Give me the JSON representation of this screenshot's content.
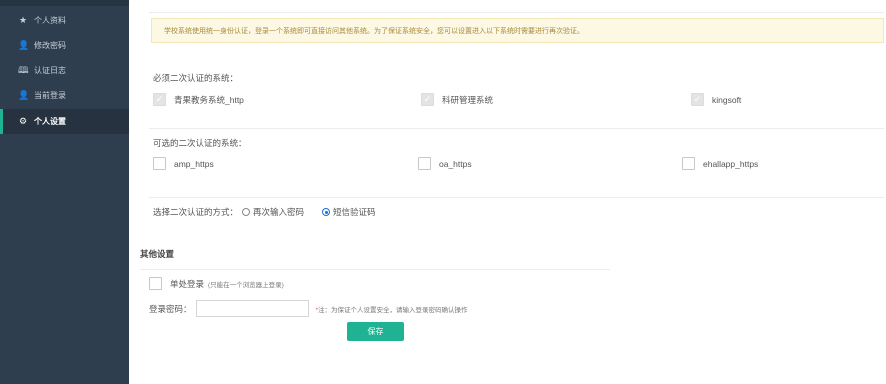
{
  "sidebar": {
    "items": [
      {
        "label": "个人资料",
        "icon": "star-icon",
        "glyph": "★"
      },
      {
        "label": "修改密码",
        "icon": "user-icon",
        "glyph": "👤"
      },
      {
        "label": "认证日志",
        "icon": "book-icon",
        "glyph": "🕮"
      },
      {
        "label": "当前登录",
        "icon": "user-lock-icon",
        "glyph": "👤"
      },
      {
        "label": "个人设置",
        "icon": "gear-icon",
        "glyph": "⚙"
      }
    ],
    "active_index": 4
  },
  "notice": "学校系统使用统一身份认证，登录一个系统即可直接访问其他系统。为了保证系统安全，您可以设置进入以下系统时需要进行再次验证。",
  "required": {
    "title": "必须二次认证的系统：",
    "systems": [
      "青果教务系统_http",
      "科研管理系统",
      "kingsoft"
    ]
  },
  "optional": {
    "title": "可选的二次认证的系统：",
    "systems": [
      "amp_https",
      "oa_https",
      "ehallapp_https"
    ]
  },
  "method": {
    "label": "选择二次认证的方式：",
    "options": [
      "再次输入密码",
      "短信验证码"
    ],
    "selected": 1
  },
  "other": {
    "title": "其他设置",
    "single_login_label": "单处登录",
    "single_login_note": "(只能在一个浏览器上登录)",
    "password_label": "登录密码：",
    "password_value": "",
    "password_note_star": "*",
    "password_note": "注：为保证个人设置安全，请输入登录密码确认操作",
    "save_label": "保存"
  },
  "colors": {
    "sidebar_bg": "#2f3e4e",
    "accent": "#1fb394",
    "notice_bg": "#fcf8e3",
    "radio_on": "#1a6fd0"
  }
}
